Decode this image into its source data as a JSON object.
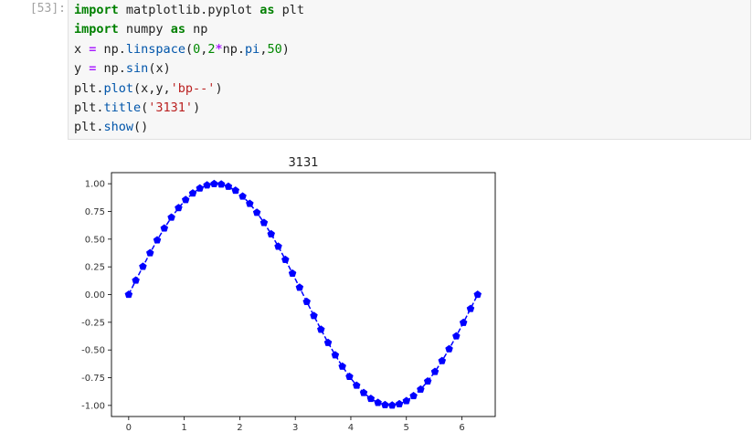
{
  "cell": {
    "prompt": "[53]:",
    "lines": [
      [
        {
          "t": "import",
          "c": "kw"
        },
        {
          "t": " matplotlib.pyplot ",
          "c": ""
        },
        {
          "t": "as",
          "c": "kw"
        },
        {
          "t": " plt",
          "c": ""
        }
      ],
      [
        {
          "t": "import",
          "c": "kw"
        },
        {
          "t": " numpy ",
          "c": ""
        },
        {
          "t": "as",
          "c": "kw"
        },
        {
          "t": " np",
          "c": ""
        }
      ],
      [
        {
          "t": "x ",
          "c": ""
        },
        {
          "t": "=",
          "c": "op"
        },
        {
          "t": " np.",
          "c": ""
        },
        {
          "t": "linspace",
          "c": "fn"
        },
        {
          "t": "(",
          "c": ""
        },
        {
          "t": "0",
          "c": "num"
        },
        {
          "t": ",",
          "c": ""
        },
        {
          "t": "2",
          "c": "num"
        },
        {
          "t": "*",
          "c": "op"
        },
        {
          "t": "np.",
          "c": ""
        },
        {
          "t": "pi",
          "c": "fn"
        },
        {
          "t": ",",
          "c": ""
        },
        {
          "t": "50",
          "c": "num"
        },
        {
          "t": ")",
          "c": ""
        }
      ],
      [
        {
          "t": "y ",
          "c": ""
        },
        {
          "t": "=",
          "c": "op"
        },
        {
          "t": " np.",
          "c": ""
        },
        {
          "t": "sin",
          "c": "fn"
        },
        {
          "t": "(x)",
          "c": ""
        }
      ],
      [
        {
          "t": "plt.",
          "c": ""
        },
        {
          "t": "plot",
          "c": "fn"
        },
        {
          "t": "(x,y,",
          "c": ""
        },
        {
          "t": "'bp--'",
          "c": "str"
        },
        {
          "t": ")",
          "c": ""
        }
      ],
      [
        {
          "t": "plt.",
          "c": ""
        },
        {
          "t": "title",
          "c": "fn"
        },
        {
          "t": "(",
          "c": ""
        },
        {
          "t": "'3131'",
          "c": "str"
        },
        {
          "t": ")",
          "c": ""
        }
      ],
      [
        {
          "t": "plt.",
          "c": ""
        },
        {
          "t": "show",
          "c": "fn"
        },
        {
          "t": "()",
          "c": ""
        }
      ]
    ]
  },
  "colors": {
    "kw": "#008000",
    "op": "#aa22ff",
    "fn": "#0055aa",
    "num": "#008800",
    "str": "#ba2121",
    "series": "#0000ff"
  },
  "chart_data": {
    "type": "line",
    "title": "3131",
    "xlabel": "",
    "ylabel": "",
    "xlim": [
      -0.31,
      6.6
    ],
    "ylim": [
      -1.1,
      1.1
    ],
    "xticks": [
      0,
      1,
      2,
      3,
      4,
      5,
      6
    ],
    "xtick_labels": [
      "0",
      "1",
      "2",
      "3",
      "4",
      "5",
      "6"
    ],
    "yticks": [
      1.0,
      0.75,
      0.5,
      0.25,
      0.0,
      -0.25,
      -0.5,
      -0.75,
      -1.0
    ],
    "ytick_labels": [
      "1.00",
      "0.75",
      "0.50",
      "0.25",
      "0.00",
      "-0.25",
      "-0.50",
      "-0.75",
      "-1.00"
    ],
    "grid": false,
    "series": [
      {
        "style": "dashed line with pentagon markers",
        "x": [
          0.0,
          0.128,
          0.256,
          0.385,
          0.513,
          0.641,
          0.769,
          0.898,
          1.026,
          1.154,
          1.282,
          1.411,
          1.539,
          1.667,
          1.795,
          1.923,
          2.052,
          2.18,
          2.308,
          2.436,
          2.565,
          2.693,
          2.821,
          2.949,
          3.077,
          3.206,
          3.334,
          3.462,
          3.59,
          3.719,
          3.847,
          3.975,
          4.103,
          4.231,
          4.36,
          4.488,
          4.616,
          4.744,
          4.873,
          5.001,
          5.129,
          5.257,
          5.385,
          5.514,
          5.642,
          5.77,
          5.898,
          6.027,
          6.155,
          6.283
        ],
        "y": [
          0.0,
          0.128,
          0.253,
          0.375,
          0.491,
          0.598,
          0.696,
          0.782,
          0.855,
          0.914,
          0.959,
          0.987,
          0.999,
          0.995,
          0.975,
          0.939,
          0.886,
          0.82,
          0.74,
          0.648,
          0.546,
          0.434,
          0.315,
          0.191,
          0.064,
          -0.064,
          -0.191,
          -0.315,
          -0.434,
          -0.546,
          -0.648,
          -0.74,
          -0.82,
          -0.886,
          -0.939,
          -0.975,
          -0.995,
          -0.999,
          -0.987,
          -0.959,
          -0.914,
          -0.855,
          -0.782,
          -0.696,
          -0.598,
          -0.491,
          -0.375,
          -0.253,
          -0.128,
          0.0
        ]
      }
    ]
  }
}
